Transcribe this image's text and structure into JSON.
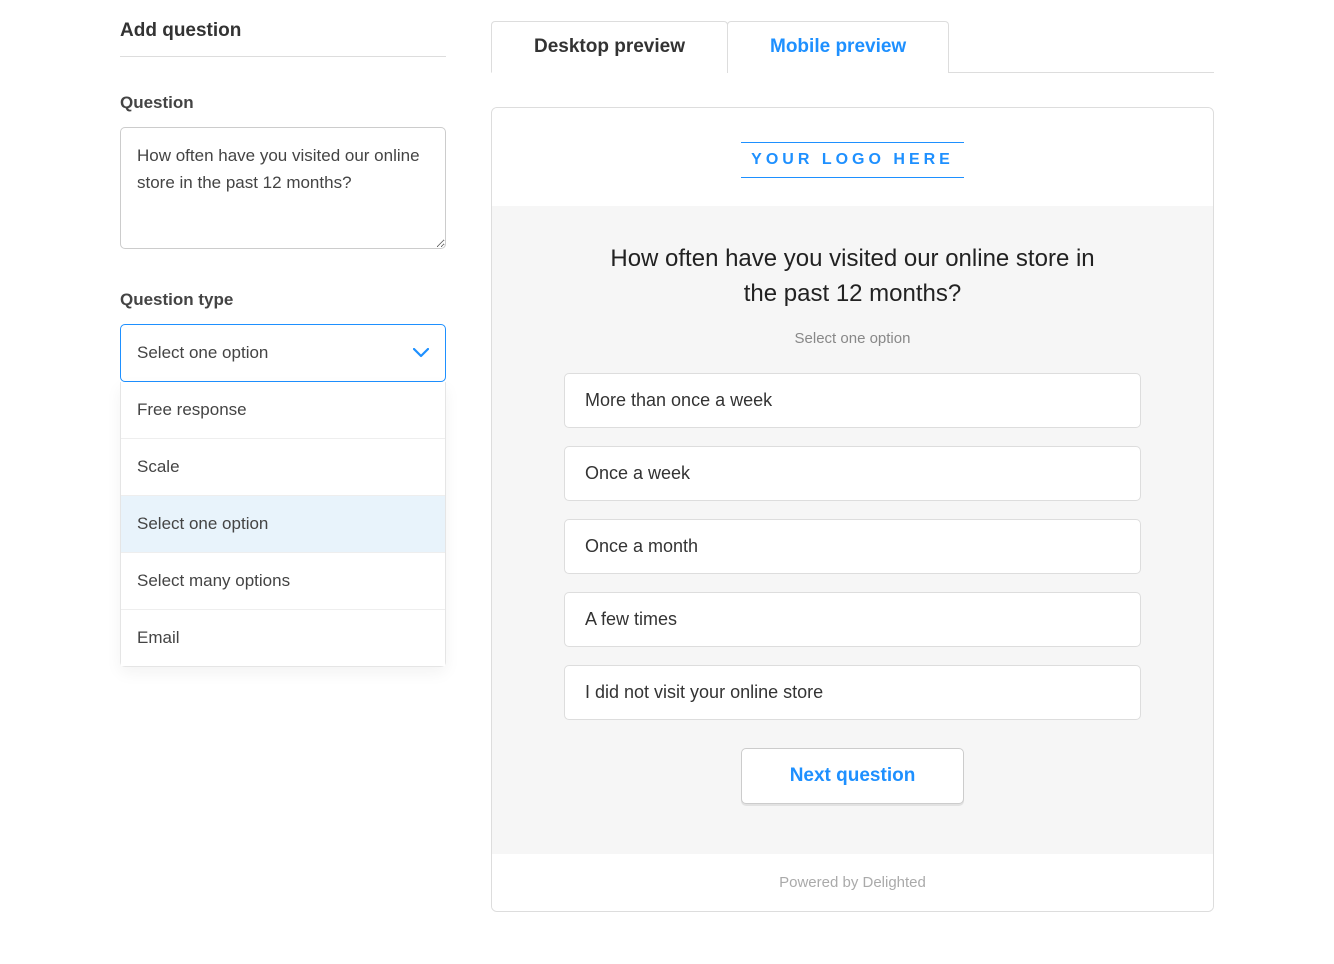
{
  "left": {
    "title": "Add question",
    "question_label": "Question",
    "question_value": "How often have you visited our online store in the past 12 months?",
    "type_label": "Question type",
    "select": {
      "value": "Select one option",
      "options": [
        {
          "label": "Free response",
          "selected": false
        },
        {
          "label": "Scale",
          "selected": false
        },
        {
          "label": "Select one option",
          "selected": true
        },
        {
          "label": "Select many options",
          "selected": false
        },
        {
          "label": "Email",
          "selected": false
        }
      ]
    }
  },
  "right": {
    "tabs": {
      "desktop": "Desktop preview",
      "mobile": "Mobile preview"
    },
    "logo_text": "YOUR LOGO HERE",
    "question": "How often have you visited our online store in the past 12 months?",
    "instruction": "Select one option",
    "options": [
      "More than once a week",
      "Once a week",
      "Once a month",
      "A few times",
      "I did not visit your online store"
    ],
    "next_label": "Next question",
    "footer": "Powered by Delighted"
  }
}
